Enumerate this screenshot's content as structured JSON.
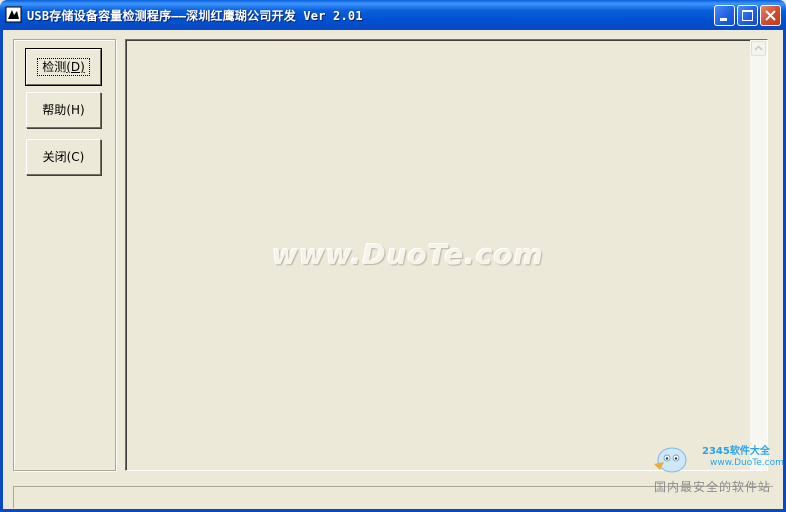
{
  "window": {
    "title": "USB存储设备容量检测程序——深圳红鹰瑚公司开发 Ver 2.01",
    "icon": "app-icon"
  },
  "buttons": {
    "detect": {
      "label": "检测",
      "mnemonic": "(D)"
    },
    "help": {
      "label": "帮助",
      "mnemonic": "(H)"
    },
    "close": {
      "label": "关闭",
      "mnemonic": "(C)"
    }
  },
  "watermark": "www.DuoTe.com",
  "badge": {
    "brand": "2345软件大全",
    "url": "www.DuoTe.com",
    "tagline": "国内最安全的软件站"
  },
  "colors": {
    "titlebar": "#0a5fd8",
    "window_bg": "#ece9d8",
    "close_button": "#d4482a"
  }
}
